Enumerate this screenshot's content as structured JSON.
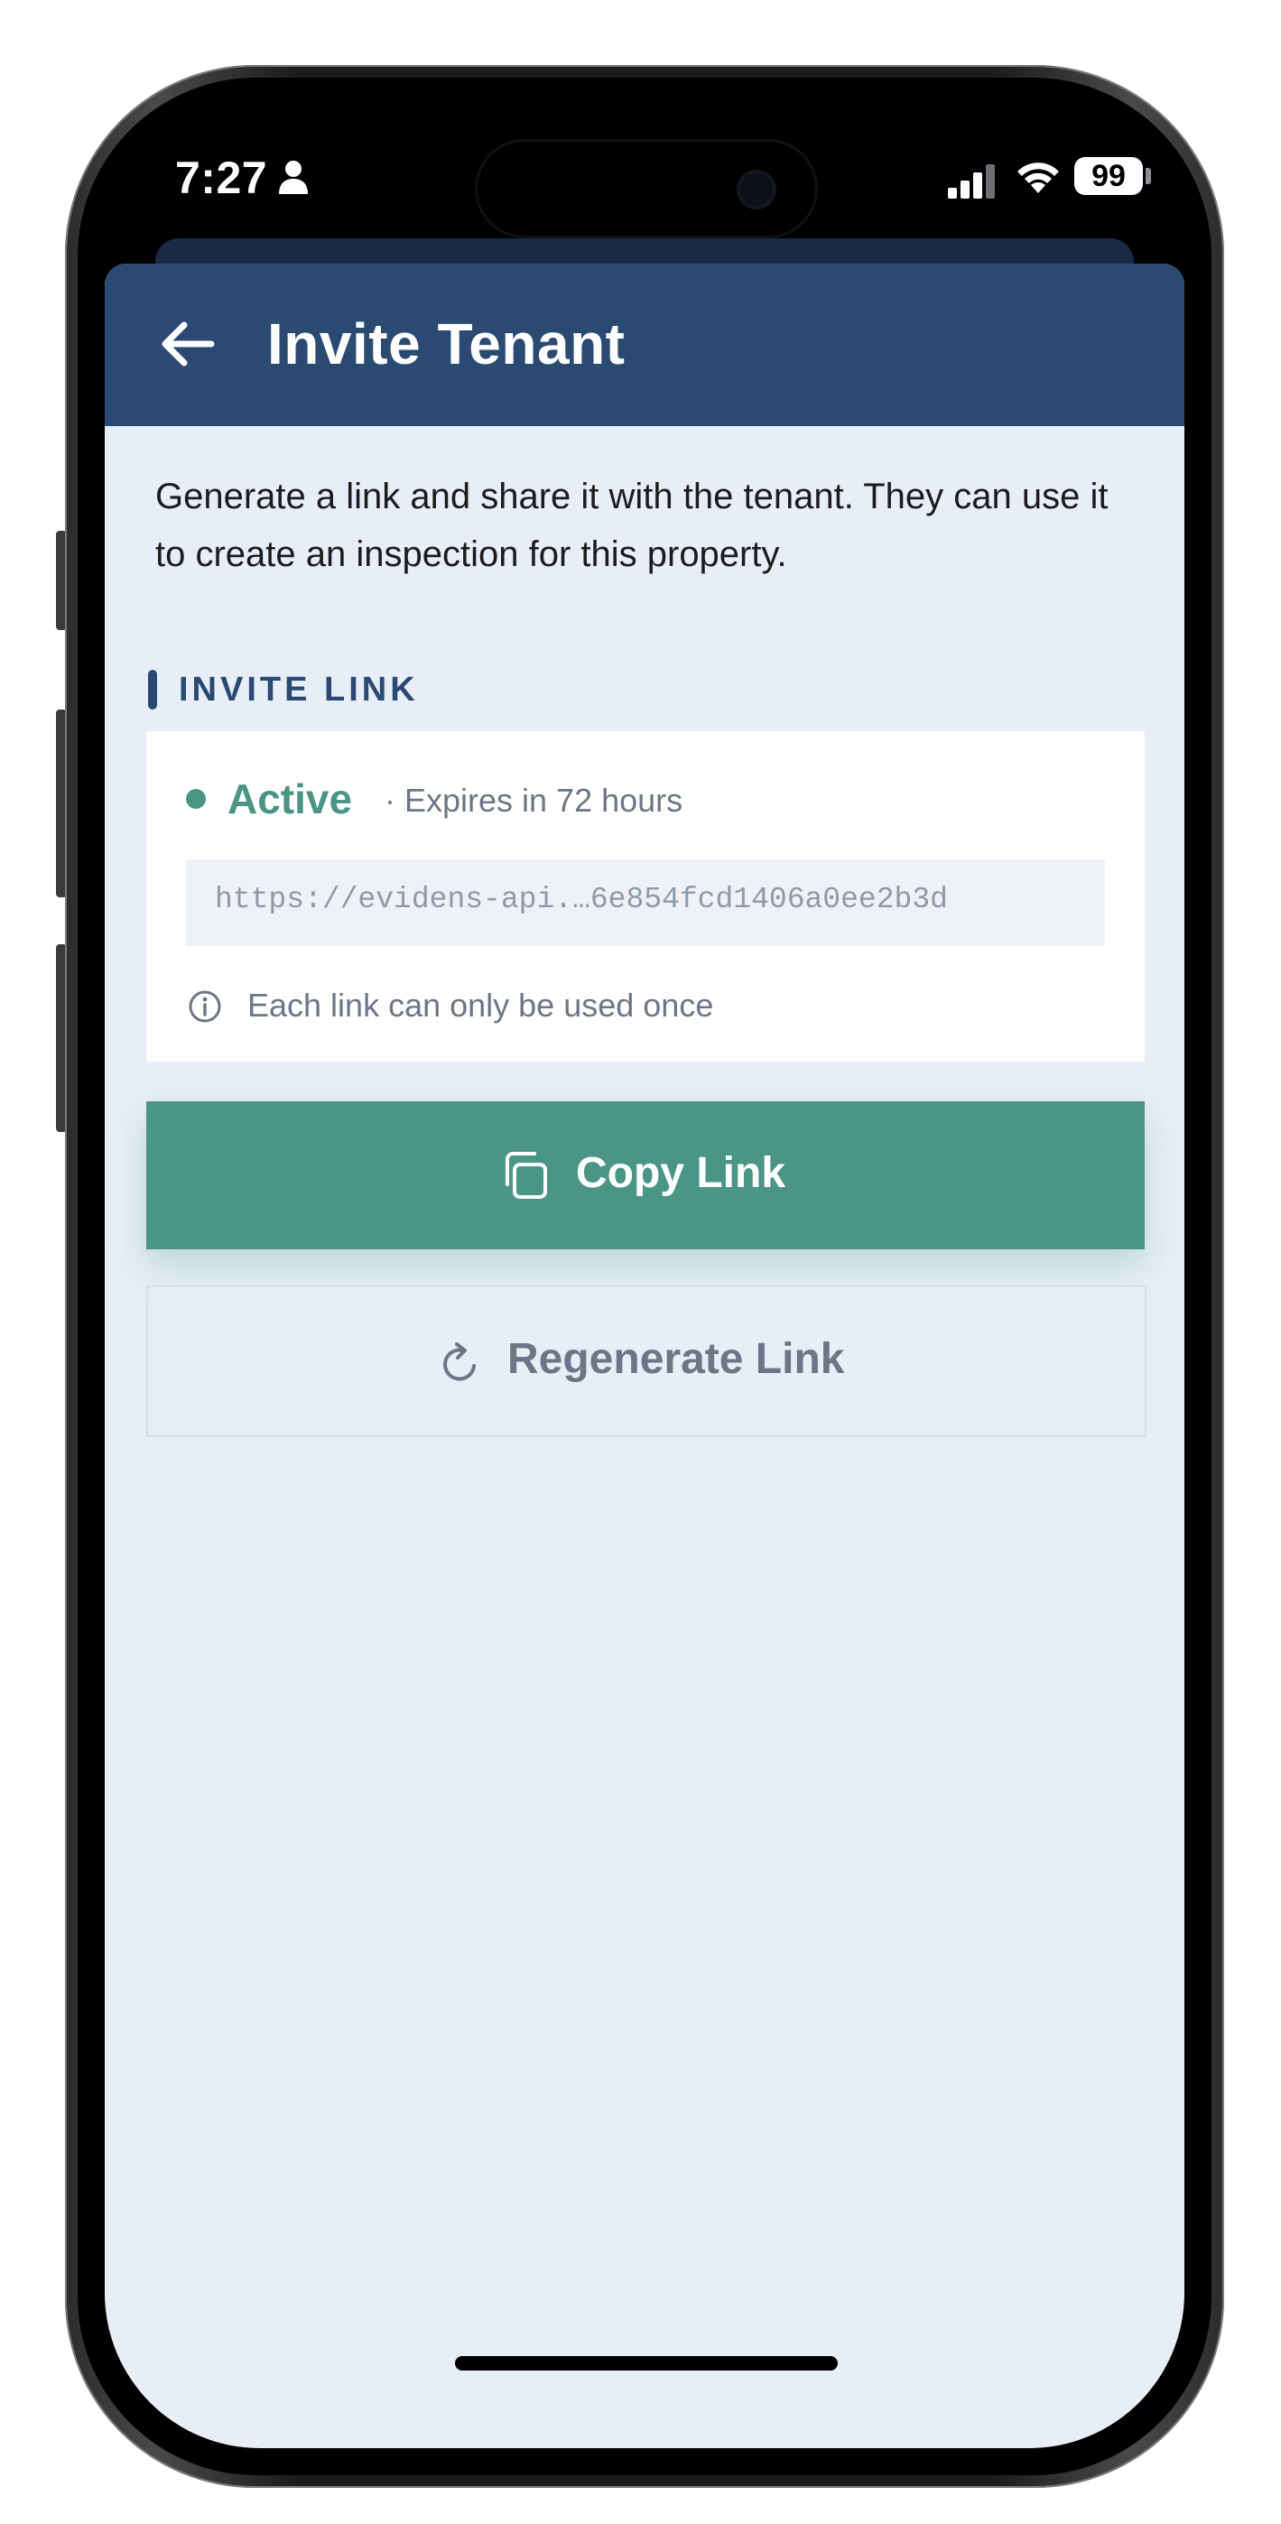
{
  "status_bar": {
    "time": "7:27",
    "battery": "99",
    "icons": [
      "person-icon",
      "signal-icon",
      "wifi-icon",
      "battery-icon"
    ]
  },
  "header": {
    "back_icon": "arrow-left-icon",
    "title": "Invite Tenant"
  },
  "description": "Generate a link and share it with the tenant. They can use it to create an inspection for this property.",
  "invite_section": {
    "title": "INVITE LINK",
    "status": "Active",
    "expiry": "· Expires in 72 hours",
    "link": "https://evidens-api.…6e854fcd1406a0ee2b3d",
    "note": "Each link can only be used once",
    "note_icon": "info-icon"
  },
  "actions": {
    "copy_label": "Copy Link",
    "copy_icon": "copy-icon",
    "regenerate_label": "Regenerate Link",
    "regenerate_icon": "refresh-icon"
  },
  "colors": {
    "header_bg": "#2b4a72",
    "page_bg": "#e7eef7",
    "accent_green": "#4a9584",
    "muted_text": "#6b7686"
  }
}
